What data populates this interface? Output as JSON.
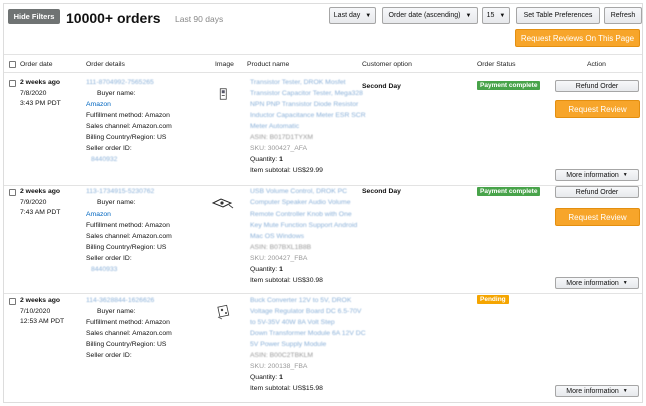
{
  "header": {
    "hide_filters": "Hide Filters",
    "title": "10000+ orders",
    "subtitle": "Last 90 days",
    "period_select": "Last day",
    "sort_select": "Order date (ascending)",
    "page_size_select": "15",
    "table_prefs": "Set Table Preferences",
    "refresh": "Refresh",
    "request_reviews_page": "Request Reviews On This Page"
  },
  "columns": {
    "order_date": "Order date",
    "order_details": "Order details",
    "image": "Image",
    "product_name": "Product name",
    "customer_option": "Customer option",
    "order_status": "Order Status",
    "action": "Action"
  },
  "labels": {
    "buyer_name": "Buyer name:",
    "fulfillment": "Fulfillment method: Amazon",
    "sales_channel": "Sales channel: Amazon.com",
    "billing": "Billing Country/Region: US",
    "seller_order_id": "Seller order ID:",
    "quantity": "Quantity:",
    "item_subtotal": "Item subtotal:",
    "refund_order": "Refund Order",
    "request_review": "Request Review",
    "more_information": "More information"
  },
  "status_colors": {
    "complete": "#48a34a",
    "pending": "#f5a500"
  },
  "orders": [
    {
      "relative": "2 weeks ago",
      "date": "7/8/2020",
      "time": "3:43 PM PDT",
      "order_id": "111-8704992-7565265",
      "buyer": "Amazon",
      "seller_id": "8440932",
      "product_lines": [
        "Transistor Tester, DROK Mosfet",
        "Transistor Capacitor Tester, Mega328",
        "NPN PNP Transistor Diode Resistor",
        "Inductor Capacitance Meter ESR SCR",
        "Meter Automatic"
      ],
      "asin": "ASIN: B017D1TYXM",
      "sku": "SKU: 300427_AFA",
      "quantity": "1",
      "subtotal": "US$29.99",
      "customer_option": "Second Day",
      "status": "Payment complete",
      "status_type": "complete"
    },
    {
      "relative": "2 weeks ago",
      "date": "7/9/2020",
      "time": "7:43 AM PDT",
      "order_id": "113-1734915-5230762",
      "buyer": "Amazon",
      "seller_id": "8440933",
      "product_lines": [
        "USB Volume Control, DROK PC",
        "Computer Speaker Audio Volume",
        "Remote Controller Knob with One",
        "Key Mute Function Support Android",
        "Mac OS Windows"
      ],
      "asin": "ASIN: B07BXL1B8B",
      "sku": "SKU: 200427_FBA",
      "quantity": "1",
      "subtotal": "US$30.98",
      "customer_option": "Second Day",
      "status": "Payment complete",
      "status_type": "complete"
    },
    {
      "relative": "2 weeks ago",
      "date": "7/10/2020",
      "time": "12:53 AM PDT",
      "order_id": "114-3628844-1626626",
      "buyer": "Amazon",
      "seller_id": "",
      "product_lines": [
        "Buck Converter 12V to 5V, DROK",
        "Voltage Regulator Board DC 6.5-70V",
        "to 5V-35V 40W 8A Volt Step",
        "Down Transformer Module 6A 12V DC",
        "5V Power Supply Module"
      ],
      "asin": "ASIN: B00C2TBKLM",
      "sku": "SKU: 200138_FBA",
      "quantity": "1",
      "subtotal": "US$15.98",
      "customer_option": "",
      "status": "Pending",
      "status_type": "pending"
    }
  ]
}
